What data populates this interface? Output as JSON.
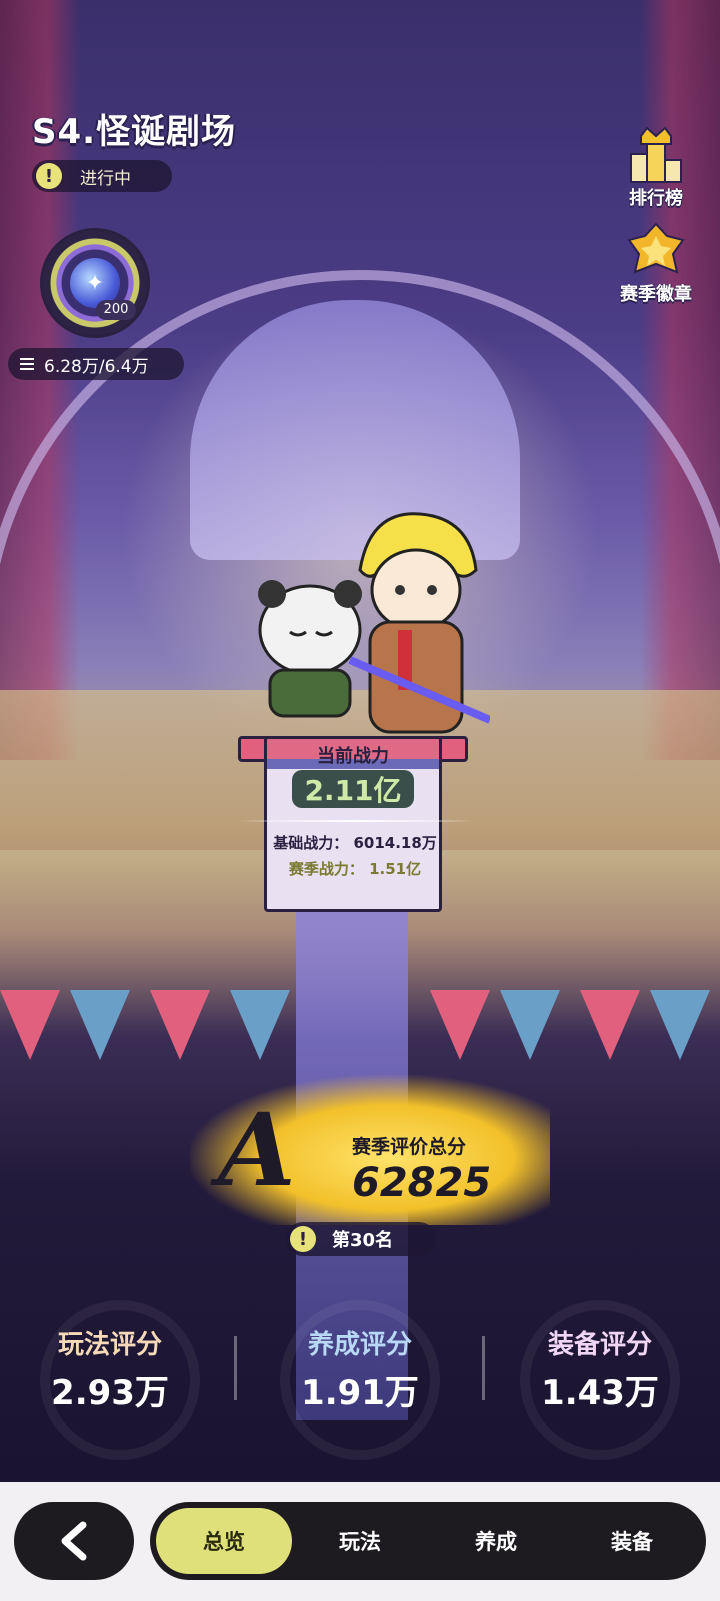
{
  "header": {
    "title": "S4.怪诞剧场",
    "status": "进行中",
    "badge_level": "200",
    "progress": "6.28万/6.4万"
  },
  "side": {
    "rank_label": "排行榜",
    "season_badge_label": "赛季徽章"
  },
  "power": {
    "label": "当前战力",
    "value": "2.11亿",
    "base": "基础战力： 6014.18万",
    "season": "赛季战力： 1.51亿"
  },
  "score": {
    "grade": "A",
    "label": "赛季评价总分",
    "value": "62825",
    "rank": "第30名"
  },
  "sub_scores": [
    {
      "name": "玩法评分",
      "value": "2.93万"
    },
    {
      "name": "养成评分",
      "value": "1.91万"
    },
    {
      "name": "装备评分",
      "value": "1.43万"
    }
  ],
  "tabs": [
    "总览",
    "玩法",
    "养成",
    "装备"
  ],
  "colors": {
    "accent": "#dfe07a",
    "bar": "#1d1b20",
    "gold": "#f2c02a"
  }
}
